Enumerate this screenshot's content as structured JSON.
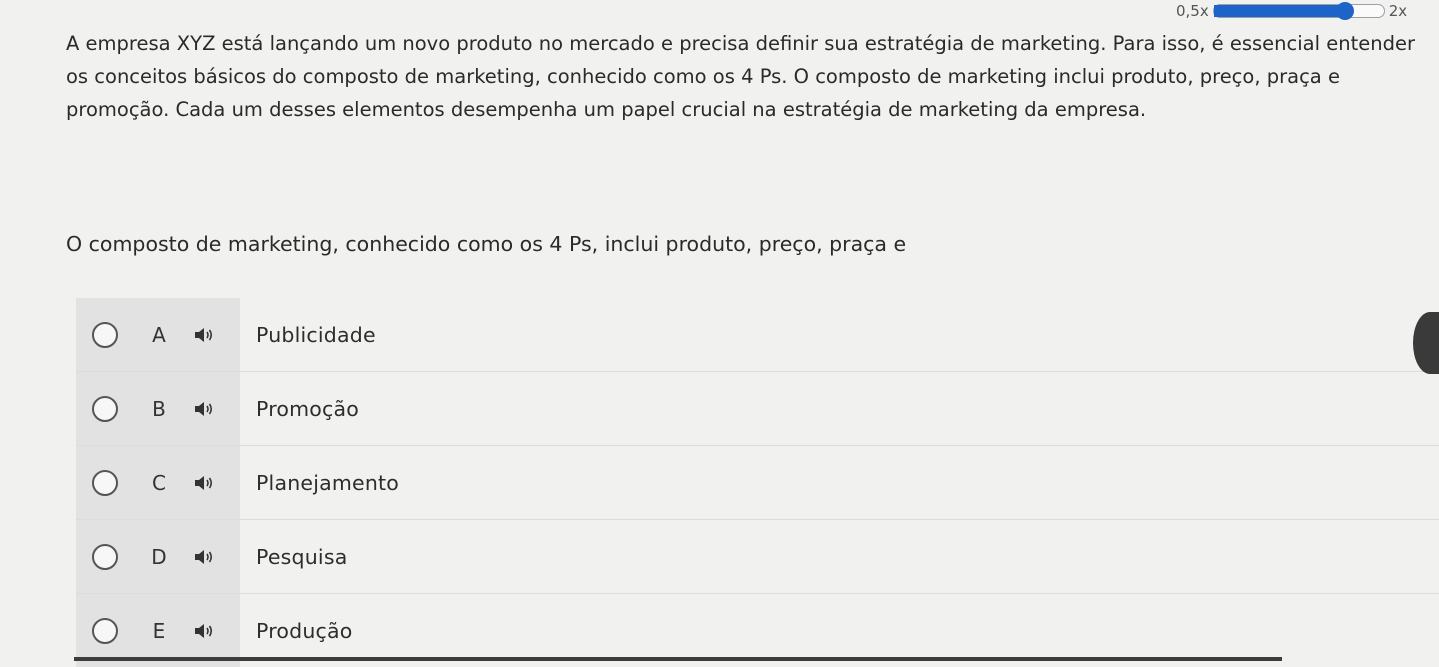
{
  "speed": {
    "min_label": "0,5x",
    "max_label": "2x",
    "level": 0.77,
    "accent_color": "#1e63c9"
  },
  "intro_text": "A empresa XYZ está lançando um novo produto no mercado e precisa definir sua estratégia de marketing. Para isso, é essencial entender os conceitos básicos do composto de marketing, conhecido como os 4 Ps. O composto de marketing inclui produto, preço, praça e promoção. Cada um desses elementos desempenha um papel crucial na estratégia de marketing da empresa.",
  "question_text": "O composto de marketing, conhecido como os 4 Ps, inclui produto, preço, praça e",
  "options": [
    {
      "letter": "A",
      "text": "Publicidade",
      "icon": "speaker-icon"
    },
    {
      "letter": "B",
      "text": "Promoção",
      "icon": "speaker-icon"
    },
    {
      "letter": "C",
      "text": "Planejamento",
      "icon": "speaker-icon"
    },
    {
      "letter": "D",
      "text": "Pesquisa",
      "icon": "speaker-icon"
    },
    {
      "letter": "E",
      "text": "Produção",
      "icon": "speaker-icon"
    }
  ]
}
